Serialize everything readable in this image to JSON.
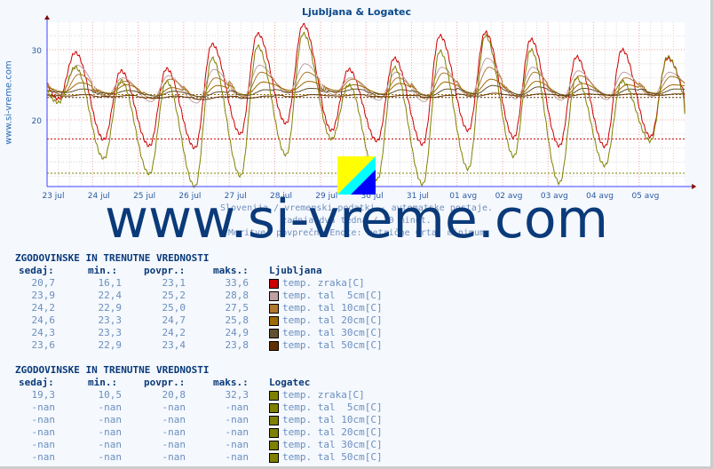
{
  "title": "Ljubljana & Logatec",
  "side_label": "www.si-vreme.com",
  "watermark": "www.si-vreme.com",
  "subtitle_lines": [
    "Slovenija / vremenski podatki - avtomatske postaje.",
    "zadnja dva tedna / 30 minut.",
    "Meritve: povprečne  Enote: metrične  Črta: minimum"
  ],
  "chart_data": {
    "type": "line",
    "title": "Ljubljana & Logatec",
    "x_tick_labels": [
      "23 jul",
      "24 jul",
      "25 jul",
      "26 jul",
      "27 jul",
      "28 jul",
      "29 jul",
      "30 jul",
      "31 jul",
      "01 avg",
      "02 avg",
      "03 avg",
      "04 avg",
      "05 avg"
    ],
    "y_tick_labels": [
      "20",
      "30"
    ],
    "ylim": [
      10.5,
      33.8
    ],
    "grid": true,
    "series": [
      {
        "name": "Ljubljana temp. zraka[C]",
        "color": "#cc0000",
        "daily_max": [
          29.6,
          27.0,
          27.3,
          30.8,
          32.3,
          33.6,
          27.2,
          28.8,
          32.0,
          32.5,
          31.5,
          29.0,
          30.0,
          28.8
        ],
        "daily_min": [
          23.0,
          17.2,
          16.3,
          16.0,
          18.0,
          19.5,
          18.5,
          17.0,
          16.5,
          18.5,
          17.5,
          16.3,
          16.2,
          17.6
        ],
        "last": 20.7
      },
      {
        "name": "Ljubljana temp. tal 5cm[C]",
        "color": "#c0a0a0",
        "daily_max": [
          27.8,
          26.0,
          26.3,
          27.2,
          27.8,
          28.0,
          26.0,
          26.8,
          27.5,
          28.8,
          27.5,
          27.0,
          26.8,
          26.8
        ],
        "daily_min": [
          23.5,
          23.2,
          22.6,
          22.4,
          23.0,
          23.8,
          23.6,
          22.8,
          22.6,
          23.3,
          23.0,
          22.8,
          22.9,
          23.3
        ],
        "last": 23.9
      },
      {
        "name": "Ljubljana temp. tal 10cm[C]",
        "color": "#b07830",
        "daily_max": [
          26.5,
          25.5,
          25.8,
          26.0,
          26.8,
          26.8,
          25.8,
          26.0,
          26.7,
          27.5,
          26.8,
          26.3,
          26.0,
          26.2
        ],
        "daily_min": [
          23.6,
          23.4,
          23.0,
          22.9,
          23.3,
          24.0,
          23.9,
          23.2,
          23.0,
          23.5,
          23.3,
          23.1,
          23.2,
          23.5
        ],
        "last": 24.2
      },
      {
        "name": "Ljubljana temp. tal 20cm[C]",
        "color": "#a06800",
        "daily_max": [
          25.3,
          25.0,
          24.6,
          24.9,
          25.4,
          25.5,
          25.0,
          25.2,
          25.4,
          25.8,
          25.5,
          25.2,
          25.0,
          25.0
        ],
        "daily_min": [
          24.0,
          23.8,
          23.4,
          23.3,
          23.6,
          24.2,
          24.2,
          23.7,
          23.5,
          23.8,
          23.6,
          23.5,
          23.5,
          23.8
        ],
        "last": 24.6
      },
      {
        "name": "Ljubljana temp. tal 30cm[C]",
        "color": "#605030",
        "daily_max": [
          24.4,
          24.2,
          24.1,
          24.0,
          24.3,
          24.5,
          24.4,
          24.3,
          24.4,
          24.9,
          24.7,
          24.5,
          24.4,
          24.4
        ],
        "daily_min": [
          23.9,
          23.7,
          23.4,
          23.3,
          23.5,
          23.9,
          24.0,
          23.6,
          23.4,
          23.7,
          23.6,
          23.5,
          23.5,
          23.7
        ],
        "last": 24.3
      },
      {
        "name": "Ljubljana temp. tal 50cm[C]",
        "color": "#603000",
        "daily_max": [
          23.6,
          23.5,
          23.4,
          23.3,
          23.4,
          23.6,
          23.6,
          23.5,
          23.5,
          23.8,
          23.7,
          23.7,
          23.7,
          23.7
        ],
        "daily_min": [
          23.4,
          23.3,
          23.1,
          22.9,
          23.1,
          23.3,
          23.4,
          23.3,
          23.2,
          23.4,
          23.4,
          23.4,
          23.5,
          23.5
        ],
        "last": 23.6
      },
      {
        "name": "Logatec temp. zraka[C]",
        "color": "#808000",
        "daily_max": [
          27.5,
          25.6,
          25.5,
          28.8,
          30.5,
          32.3,
          25.0,
          27.5,
          29.8,
          32.0,
          30.0,
          26.0,
          25.5,
          29.0
        ],
        "daily_min": [
          22.5,
          14.5,
          12.3,
          10.5,
          12.0,
          15.0,
          17.3,
          11.5,
          10.8,
          13.0,
          14.8,
          11.0,
          13.5,
          17.0
        ],
        "last": 19.3
      }
    ],
    "reference_lines": [
      {
        "value": 17.3,
        "color": "#cc0000"
      },
      {
        "value": 12.4,
        "color": "#808000"
      },
      {
        "value": 23.6,
        "color": "#a06800"
      },
      {
        "value": 23.2,
        "color": "#603000"
      }
    ]
  },
  "tables": [
    {
      "heading": "ZGODOVINSKE IN TRENUTNE VREDNOSTI",
      "station": "Ljubljana",
      "cols": [
        "sedaj:",
        "min.:",
        "povpr.:",
        "maks.:"
      ],
      "rows": [
        {
          "v": [
            "20,7",
            "16,1",
            "23,1",
            "33,6"
          ],
          "color": "#cc0000",
          "label": "temp. zraka[C]"
        },
        {
          "v": [
            "23,9",
            "22,4",
            "25,2",
            "28,8"
          ],
          "color": "#c0a0a0",
          "label": "temp. tal  5cm[C]"
        },
        {
          "v": [
            "24,2",
            "22,9",
            "25,0",
            "27,5"
          ],
          "color": "#b07830",
          "label": "temp. tal 10cm[C]"
        },
        {
          "v": [
            "24,6",
            "23,3",
            "24,7",
            "25,8"
          ],
          "color": "#a06800",
          "label": "temp. tal 20cm[C]"
        },
        {
          "v": [
            "24,3",
            "23,3",
            "24,2",
            "24,9"
          ],
          "color": "#605030",
          "label": "temp. tal 30cm[C]"
        },
        {
          "v": [
            "23,6",
            "22,9",
            "23,4",
            "23,8"
          ],
          "color": "#603000",
          "label": "temp. tal 50cm[C]"
        }
      ]
    },
    {
      "heading": "ZGODOVINSKE IN TRENUTNE VREDNOSTI",
      "station": "Logatec",
      "cols": [
        "sedaj:",
        "min.:",
        "povpr.:",
        "maks.:"
      ],
      "rows": [
        {
          "v": [
            "19,3",
            "10,5",
            "20,8",
            "32,3"
          ],
          "color": "#808000",
          "label": "temp. zraka[C]"
        },
        {
          "v": [
            "-nan",
            "-nan",
            "-nan",
            "-nan"
          ],
          "color": "#808000",
          "label": "temp. tal  5cm[C]"
        },
        {
          "v": [
            "-nan",
            "-nan",
            "-nan",
            "-nan"
          ],
          "color": "#808000",
          "label": "temp. tal 10cm[C]"
        },
        {
          "v": [
            "-nan",
            "-nan",
            "-nan",
            "-nan"
          ],
          "color": "#808000",
          "label": "temp. tal 20cm[C]"
        },
        {
          "v": [
            "-nan",
            "-nan",
            "-nan",
            "-nan"
          ],
          "color": "#808000",
          "label": "temp. tal 30cm[C]"
        },
        {
          "v": [
            "-nan",
            "-nan",
            "-nan",
            "-nan"
          ],
          "color": "#808000",
          "label": "temp. tal 50cm[C]"
        }
      ]
    }
  ]
}
